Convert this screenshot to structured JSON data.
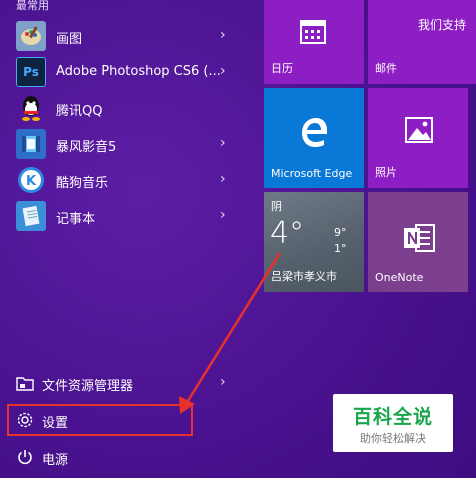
{
  "section_label": "最常用",
  "apps": [
    {
      "label": "画图",
      "icon": "paint-icon",
      "has_submenu": true
    },
    {
      "label": "Adobe Photoshop CS6 (...",
      "icon": "photoshop-icon",
      "icon_text": "Ps",
      "has_submenu": true
    },
    {
      "label": "腾讯QQ",
      "icon": "qq-icon",
      "has_submenu": false
    },
    {
      "label": "暴风影音5",
      "icon": "baofeng-icon",
      "has_submenu": true
    },
    {
      "label": "酷狗音乐",
      "icon": "kugou-icon",
      "icon_text": "K",
      "has_submenu": true
    },
    {
      "label": "记事本",
      "icon": "notepad-icon",
      "has_submenu": true
    }
  ],
  "bottom": {
    "file_explorer": "文件资源管理器",
    "settings": "设置",
    "power": "电源"
  },
  "tiles": {
    "calendar": {
      "label": "日历",
      "icon": "calendar-icon"
    },
    "mail": {
      "label": "邮件",
      "header": "我们支持",
      "icon": "mail-icon"
    },
    "edge": {
      "label": "Microsoft Edge",
      "icon": "edge-icon"
    },
    "photos": {
      "label": "照片",
      "icon": "photos-icon"
    },
    "weather": {
      "condition": "阴",
      "temp": "4°",
      "high": "9°",
      "low": "1°",
      "location": "吕梁市孝义市"
    },
    "onenote": {
      "label": "OneNote",
      "icon": "onenote-icon"
    }
  },
  "watermark": {
    "title": "百科全说",
    "subtitle": "助你轻松解决"
  },
  "colors": {
    "tile_purple": "#8c1ec4",
    "tile_blue": "#0a78d6",
    "onenote": "#7b3f8e",
    "highlight": "#e8312d",
    "watermark_green": "#1aa44c"
  }
}
